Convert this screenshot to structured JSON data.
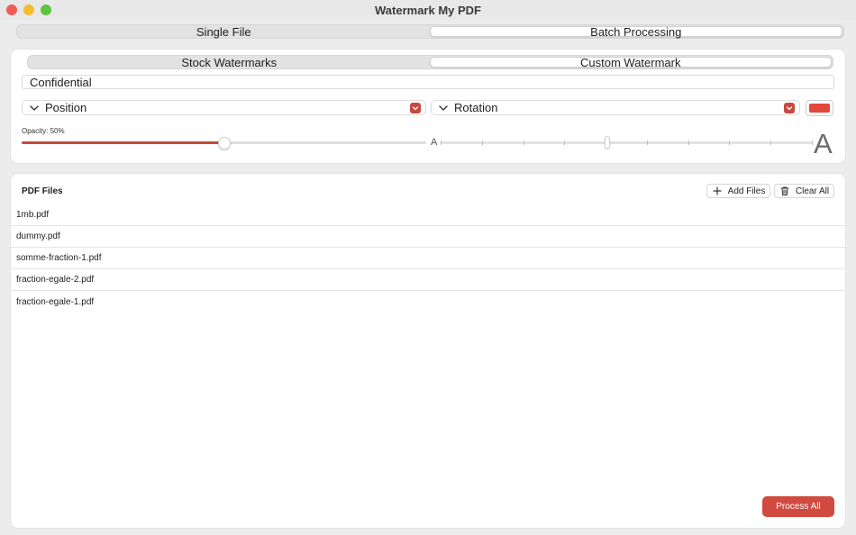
{
  "window": {
    "title": "Watermark My PDF"
  },
  "mode_tabs": [
    {
      "label": "Single File",
      "active": false
    },
    {
      "label": "Batch Processing",
      "active": true
    }
  ],
  "watermark_tabs": [
    {
      "label": "Stock Watermarks",
      "active": false
    },
    {
      "label": "Custom Watermark",
      "active": true
    }
  ],
  "watermark_text": {
    "value": "Confidential"
  },
  "position_popup": {
    "label": "Position"
  },
  "rotation_popup": {
    "label": "Rotation"
  },
  "color": {
    "value": "#e2473c"
  },
  "opacity": {
    "label": "Opacity: 50%",
    "value": 0.5
  },
  "size_slider": {
    "min_glyph": "A",
    "max_glyph": "A",
    "value": 0.45
  },
  "files": {
    "title": "PDF Files",
    "add_label": "Add Files",
    "clear_label": "Clear All",
    "items": [
      {
        "name": "1mb.pdf"
      },
      {
        "name": "dummy.pdf"
      },
      {
        "name": "somme-fraction-1.pdf"
      },
      {
        "name": "fraction-egale-2.pdf"
      },
      {
        "name": "fraction-egale-1.pdf"
      }
    ]
  },
  "process_button": {
    "label": "Process All"
  },
  "colors": {
    "accent": "#c7483d",
    "process": "#d04a3f"
  }
}
